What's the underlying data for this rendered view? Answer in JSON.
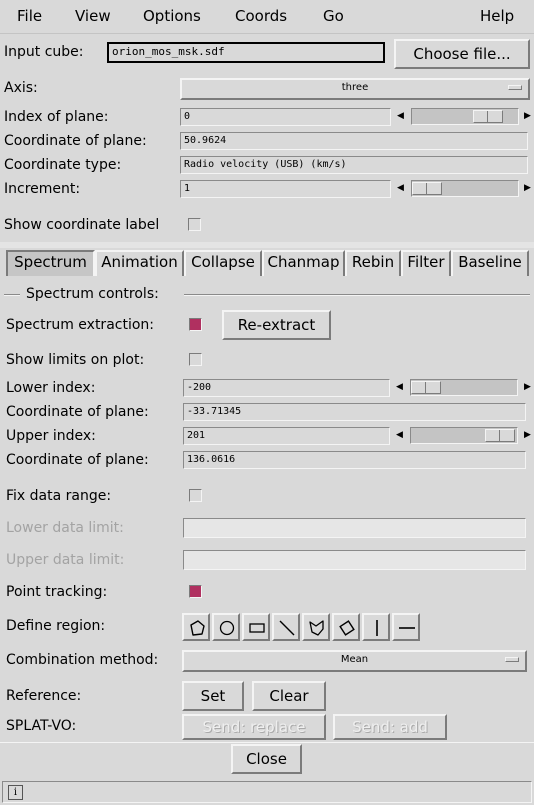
{
  "menubar": {
    "file": "File",
    "view": "View",
    "options": "Options",
    "coords": "Coords",
    "go": "Go",
    "help": "Help"
  },
  "input": {
    "label": "Input cube:",
    "value": "orion_mos_msk.sdf",
    "choose_button": "Choose file..."
  },
  "axis": {
    "label": "Axis:",
    "value": "three"
  },
  "index_of_plane": {
    "label": "Index of plane:",
    "value": "0",
    "slider_fraction": 0.82
  },
  "coordinate_of_plane": {
    "label": "Coordinate of plane:",
    "value": "50.9624"
  },
  "coordinate_type": {
    "label": "Coordinate type:",
    "value": "Radio velocity (USB) (km/s)"
  },
  "increment": {
    "label": "Increment:",
    "value": "1",
    "slider_fraction": 0.0
  },
  "show_coordinate_label": {
    "label": "Show coordinate label",
    "checked": false
  },
  "tabs": [
    "Spectrum",
    "Animation",
    "Collapse",
    "Chanmap",
    "Rebin",
    "Filter",
    "Baseline"
  ],
  "spectrum": {
    "section_title": "Spectrum controls:",
    "extraction_label": "Spectrum extraction:",
    "extraction_checked": true,
    "reextract_button": "Re-extract",
    "show_limits_label": "Show limits on plot:",
    "show_limits_checked": false,
    "lower_index_label": "Lower index:",
    "lower_index_value": "-200",
    "lower_index_fraction": 0.0,
    "lower_coord_label": "Coordinate of plane:",
    "lower_coord_value": "-33.71345",
    "upper_index_label": "Upper index:",
    "upper_index_value": "201",
    "upper_index_fraction": 1.0,
    "upper_coord_label": "Coordinate of plane:",
    "upper_coord_value": "136.0616",
    "fix_range_label": "Fix data range:",
    "fix_range_checked": false,
    "lower_limit_label": "Lower data limit:",
    "lower_limit_value": "",
    "upper_limit_label": "Upper data limit:",
    "upper_limit_value": "",
    "point_tracking_label": "Point tracking:",
    "point_tracking_checked": true,
    "define_region_label": "Define region:",
    "region_tools": [
      "polygon-icon",
      "circle-icon",
      "rectangle-icon",
      "line-icon",
      "freehand-icon",
      "diamond-icon",
      "vertical-line-icon",
      "horizontal-line-icon"
    ],
    "combination_label": "Combination method:",
    "combination_value": "Mean",
    "reference_label": "Reference:",
    "set_button": "Set",
    "clear_button": "Clear",
    "splat_label": "SPLAT-VO:",
    "send_replace_button": "Send: replace",
    "send_add_button": "Send: add"
  },
  "close_button": "Close",
  "status_icon": "info-icon",
  "colors": {
    "background": "#d9d9d9",
    "checked": "#b03060",
    "disabled_text": "#a3a3a3"
  }
}
